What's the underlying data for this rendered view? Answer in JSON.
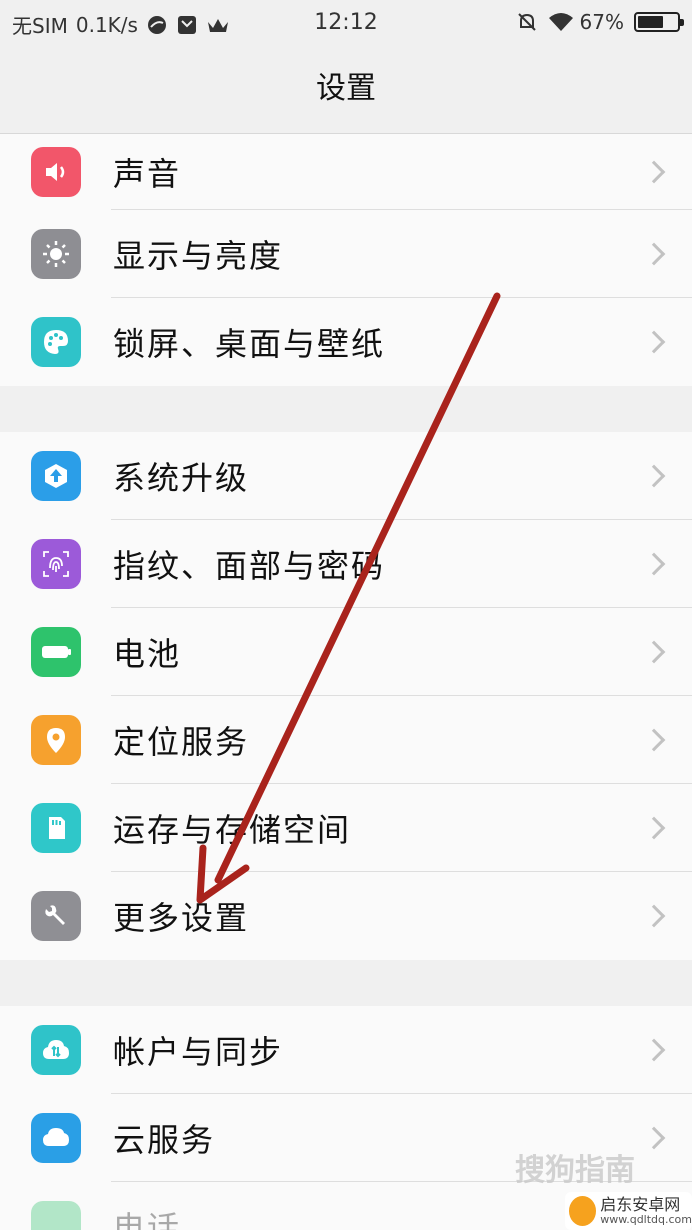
{
  "status_bar": {
    "carrier": "无SIM",
    "speed": "0.1K/s",
    "time": "12:12",
    "battery": "67%",
    "battery_level": 0.67
  },
  "header": {
    "title": "设置"
  },
  "groups": [
    {
      "items": [
        {
          "label": "声音",
          "icon": "speaker-icon",
          "color": "#f2566a"
        },
        {
          "label": "显示与亮度",
          "icon": "sun-icon",
          "color": "#8e8e93"
        },
        {
          "label": "锁屏、桌面与壁纸",
          "icon": "palette-icon",
          "color": "#2fc3c9"
        }
      ]
    },
    {
      "items": [
        {
          "label": "系统升级",
          "icon": "upgrade-icon",
          "color": "#2b9ee8"
        },
        {
          "label": "指纹、面部与密码",
          "icon": "fingerprint-icon",
          "color": "#9c5ad9"
        },
        {
          "label": "电池",
          "icon": "battery-icon",
          "color": "#2ec36c"
        },
        {
          "label": "定位服务",
          "icon": "location-icon",
          "color": "#f6a12e"
        },
        {
          "label": "运存与存储空间",
          "icon": "sdcard-icon",
          "color": "#2fc7c9"
        },
        {
          "label": "更多设置",
          "icon": "wrench-icon",
          "color": "#8f8f94"
        }
      ]
    },
    {
      "items": [
        {
          "label": "帐户与同步",
          "icon": "sync-icon",
          "color": "#2fc3c9"
        },
        {
          "label": "云服务",
          "icon": "cloud-icon",
          "color": "#2a9fe6"
        },
        {
          "label": "电话",
          "icon": "phone-icon",
          "color": "#2ec36c"
        }
      ]
    }
  ],
  "watermarks": {
    "sogou": "搜狗指南",
    "qdl_name": "启东安卓网",
    "qdl_url": "www.qdltdq.com"
  },
  "annotation_color": "#a9231c"
}
